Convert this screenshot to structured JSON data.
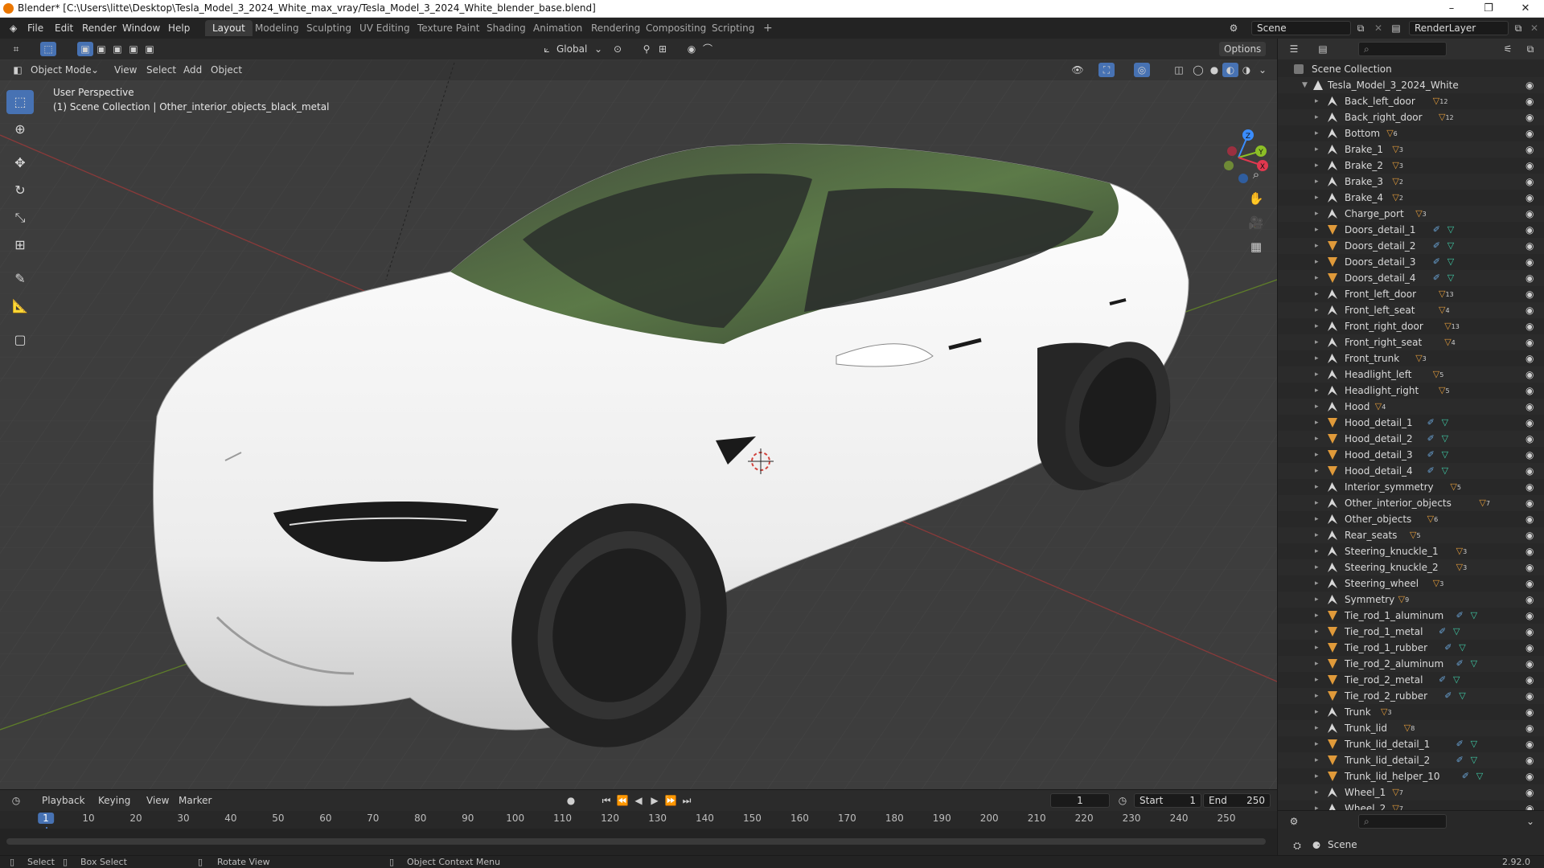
{
  "titlebar": {
    "title": "Blender* [C:\\Users\\litte\\Desktop\\Tesla_Model_3_2024_White_max_vray/Tesla_Model_3_2024_White_blender_base.blend]",
    "minimize": "–",
    "maximize": "❐",
    "close": "✕"
  },
  "menu": [
    "File",
    "Edit",
    "Render",
    "Window",
    "Help"
  ],
  "workspaces": [
    "Layout",
    "Modeling",
    "Sculpting",
    "UV Editing",
    "Texture Paint",
    "Shading",
    "Animation",
    "Rendering",
    "Compositing",
    "Scripting"
  ],
  "add_workspace": "+",
  "scene": {
    "label": "Scene",
    "view_layer": "RenderLayer"
  },
  "viewport": {
    "mode": "Object Mode",
    "menu": [
      "View",
      "Select",
      "Add",
      "Object"
    ],
    "transform_orientation": "Global",
    "options": "Options",
    "perspective": "User Perspective",
    "context": "(1) Scene Collection | Other_interior_objects_black_metal",
    "gizmo_axes": {
      "z": "Z",
      "y": "Y",
      "x": "X"
    },
    "colors": {
      "x": "#e0384f",
      "y": "#8cbf26",
      "z": "#3a8dff"
    }
  },
  "outliner": {
    "root": "Scene Collection",
    "collection": "Tesla_Model_3_2024_White",
    "items": [
      {
        "name": "Back_left_door",
        "icon": "armature-icon",
        "badge": "12",
        "eye": "eye-icon"
      },
      {
        "name": "Back_right_door",
        "icon": "armature-icon",
        "badge": "12",
        "eye": "eye-icon"
      },
      {
        "name": "Bottom",
        "icon": "armature-icon",
        "badge": "6",
        "eye": "eye-icon"
      },
      {
        "name": "Brake_1",
        "icon": "armature-icon",
        "badge": "3",
        "eye": "eye-icon"
      },
      {
        "name": "Brake_2",
        "icon": "armature-icon",
        "badge": "3",
        "eye": "eye-icon"
      },
      {
        "name": "Brake_3",
        "icon": "armature-icon",
        "badge": "2",
        "eye": "eye-icon"
      },
      {
        "name": "Brake_4",
        "icon": "armature-icon",
        "badge": "2",
        "eye": "eye-icon"
      },
      {
        "name": "Charge_port",
        "icon": "armature-icon",
        "badge": "3",
        "eye": "eye-icon"
      },
      {
        "name": "Doors_detail_1",
        "icon": "mesh-icon",
        "badge": "",
        "eye": "eye-icon"
      },
      {
        "name": "Doors_detail_2",
        "icon": "mesh-icon",
        "badge": "",
        "eye": "eye-icon"
      },
      {
        "name": "Doors_detail_3",
        "icon": "mesh-icon",
        "badge": "",
        "eye": "eye-icon"
      },
      {
        "name": "Doors_detail_4",
        "icon": "mesh-icon",
        "badge": "",
        "eye": "eye-icon"
      },
      {
        "name": "Front_left_door",
        "icon": "armature-icon",
        "badge": "13",
        "eye": "eye-icon"
      },
      {
        "name": "Front_left_seat",
        "icon": "armature-icon",
        "badge": "4",
        "eye": "eye-icon"
      },
      {
        "name": "Front_right_door",
        "icon": "armature-icon",
        "badge": "13",
        "eye": "eye-icon"
      },
      {
        "name": "Front_right_seat",
        "icon": "armature-icon",
        "badge": "4",
        "eye": "eye-icon"
      },
      {
        "name": "Front_trunk",
        "icon": "armature-icon",
        "badge": "3",
        "eye": "eye-icon"
      },
      {
        "name": "Headlight_left",
        "icon": "armature-icon",
        "badge": "5",
        "eye": "eye-icon"
      },
      {
        "name": "Headlight_right",
        "icon": "armature-icon",
        "badge": "5",
        "eye": "eye-icon"
      },
      {
        "name": "Hood",
        "icon": "armature-icon",
        "badge": "4",
        "eye": "eye-icon"
      },
      {
        "name": "Hood_detail_1",
        "icon": "mesh-icon",
        "badge": "",
        "eye": "eye-icon"
      },
      {
        "name": "Hood_detail_2",
        "icon": "mesh-icon",
        "badge": "",
        "eye": "eye-icon"
      },
      {
        "name": "Hood_detail_3",
        "icon": "mesh-icon",
        "badge": "",
        "eye": "eye-icon"
      },
      {
        "name": "Hood_detail_4",
        "icon": "mesh-icon",
        "badge": "",
        "eye": "eye-icon"
      },
      {
        "name": "Interior_symmetry",
        "icon": "armature-icon",
        "badge": "5",
        "eye": "eye-icon"
      },
      {
        "name": "Other_interior_objects",
        "icon": "armature-icon",
        "badge": "7",
        "eye": "eye-icon"
      },
      {
        "name": "Other_objects",
        "icon": "armature-icon",
        "badge": "6",
        "eye": "eye-icon"
      },
      {
        "name": "Rear_seats",
        "icon": "armature-icon",
        "badge": "5",
        "eye": "eye-icon"
      },
      {
        "name": "Steering_knuckle_1",
        "icon": "armature-icon",
        "badge": "3",
        "eye": "eye-icon"
      },
      {
        "name": "Steering_knuckle_2",
        "icon": "armature-icon",
        "badge": "3",
        "eye": "eye-icon"
      },
      {
        "name": "Steering_wheel",
        "icon": "armature-icon",
        "badge": "3",
        "eye": "eye-icon"
      },
      {
        "name": "Symmetry",
        "icon": "armature-icon",
        "badge": "9",
        "eye": "eye-icon"
      },
      {
        "name": "Tie_rod_1_aluminum",
        "icon": "mesh-icon",
        "badge": "",
        "eye": "eye-icon"
      },
      {
        "name": "Tie_rod_1_metal",
        "icon": "mesh-icon",
        "badge": "",
        "eye": "eye-icon"
      },
      {
        "name": "Tie_rod_1_rubber",
        "icon": "mesh-icon",
        "badge": "",
        "eye": "eye-icon"
      },
      {
        "name": "Tie_rod_2_aluminum",
        "icon": "mesh-icon",
        "badge": "",
        "eye": "eye-icon"
      },
      {
        "name": "Tie_rod_2_metal",
        "icon": "mesh-icon",
        "badge": "",
        "eye": "eye-icon"
      },
      {
        "name": "Tie_rod_2_rubber",
        "icon": "mesh-icon",
        "badge": "",
        "eye": "eye-icon"
      },
      {
        "name": "Trunk",
        "icon": "armature-icon",
        "badge": "3",
        "eye": "eye-icon"
      },
      {
        "name": "Trunk_lid",
        "icon": "armature-icon",
        "badge": "8",
        "eye": "eye-icon"
      },
      {
        "name": "Trunk_lid_detail_1",
        "icon": "mesh-icon",
        "badge": "",
        "eye": "eye-icon"
      },
      {
        "name": "Trunk_lid_detail_2",
        "icon": "mesh-icon",
        "badge": "",
        "eye": "eye-icon"
      },
      {
        "name": "Trunk_lid_helper_10",
        "icon": "mesh-icon",
        "badge": "",
        "eye": "eye-icon"
      },
      {
        "name": "Wheel_1",
        "icon": "armature-icon",
        "badge": "7",
        "eye": "eye-icon"
      },
      {
        "name": "Wheel_2",
        "icon": "armature-icon",
        "badge": "7",
        "eye": "eye-icon"
      }
    ]
  },
  "properties": {
    "scene": "Scene"
  },
  "timeline": {
    "menu": [
      "Playback",
      "Keying",
      "View",
      "Marker"
    ],
    "current_frame": "1",
    "start_label": "Start",
    "start": "1",
    "end_label": "End",
    "end": "250",
    "ticks": [
      "1",
      "10",
      "20",
      "30",
      "40",
      "50",
      "60",
      "70",
      "80",
      "90",
      "100",
      "110",
      "120",
      "130",
      "140",
      "150",
      "160",
      "170",
      "180",
      "190",
      "200",
      "210",
      "220",
      "230",
      "240",
      "250"
    ]
  },
  "status": {
    "select": "Select",
    "box_select": "Box Select",
    "rotate_view": "Rotate View",
    "context_menu": "Object Context Menu",
    "version": "2.92.0"
  }
}
